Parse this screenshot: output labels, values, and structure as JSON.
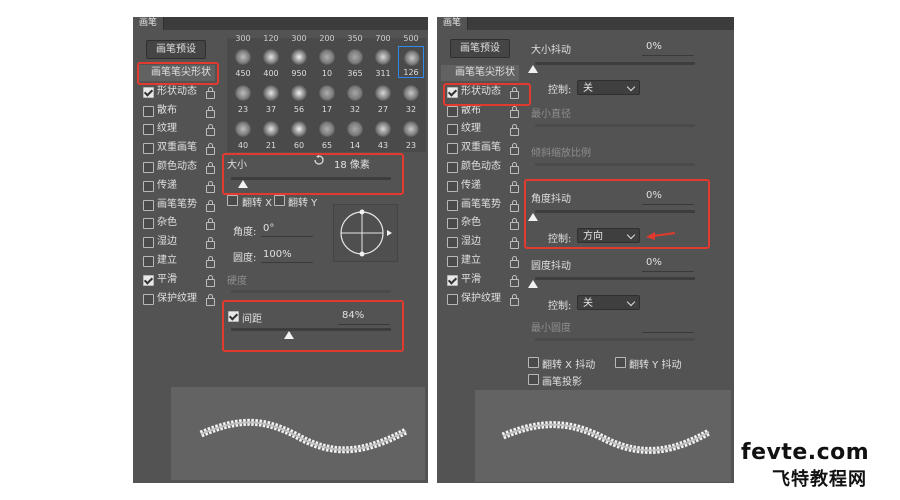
{
  "left_panel": {
    "tab": "画笔",
    "preset_button": "画笔预设",
    "menu": [
      {
        "label": "画笔笔尖形状",
        "checkbox": false,
        "checked": false
      },
      {
        "label": "形状动态",
        "checkbox": true,
        "checked": true
      },
      {
        "label": "散布",
        "checkbox": true,
        "checked": false
      },
      {
        "label": "纹理",
        "checkbox": true,
        "checked": false
      },
      {
        "label": "双重画笔",
        "checkbox": true,
        "checked": false
      },
      {
        "label": "颜色动态",
        "checkbox": true,
        "checked": false
      },
      {
        "label": "传递",
        "checkbox": true,
        "checked": false
      },
      {
        "label": "画笔笔势",
        "checkbox": true,
        "checked": false
      },
      {
        "label": "杂色",
        "checkbox": true,
        "checked": false
      },
      {
        "label": "湿边",
        "checkbox": true,
        "checked": false
      },
      {
        "label": "建立",
        "checkbox": true,
        "checked": false
      },
      {
        "label": "平滑",
        "checkbox": true,
        "checked": true
      },
      {
        "label": "保护纹理",
        "checkbox": true,
        "checked": false
      }
    ],
    "brush_row0": [
      "300",
      "120",
      "300",
      "200",
      "350",
      "700",
      "500"
    ],
    "brush_grid": [
      {
        "size": "450"
      },
      {
        "size": "400"
      },
      {
        "size": "950"
      },
      {
        "size": "10"
      },
      {
        "size": "365"
      },
      {
        "size": "311"
      },
      {
        "size": "126",
        "selected": true
      },
      {
        "size": "23"
      },
      {
        "size": "37"
      },
      {
        "size": "56"
      },
      {
        "size": "17"
      },
      {
        "size": "32"
      },
      {
        "size": "27"
      },
      {
        "size": "32"
      },
      {
        "size": "40"
      },
      {
        "size": "21"
      },
      {
        "size": "60"
      },
      {
        "size": "65"
      },
      {
        "size": "14"
      },
      {
        "size": "43"
      },
      {
        "size": "23"
      }
    ],
    "size_label": "大小",
    "size_value": "18 像素",
    "flip_x": "翻转 X",
    "flip_y": "翻转 Y",
    "angle_label": "角度:",
    "angle_value": "0°",
    "roundness_label": "圆度:",
    "roundness_value": "100%",
    "hardness_label": "硬度",
    "spacing_label": "间距",
    "spacing_value": "84%",
    "spacing_fraction": 0.84
  },
  "right_panel": {
    "tab": "画笔",
    "preset_button": "画笔预设",
    "menu": [
      {
        "label": "画笔笔尖形状",
        "checkbox": false,
        "checked": false
      },
      {
        "label": "形状动态",
        "checkbox": true,
        "checked": true
      },
      {
        "label": "散布",
        "checkbox": true,
        "checked": false
      },
      {
        "label": "纹理",
        "checkbox": true,
        "checked": false
      },
      {
        "label": "双重画笔",
        "checkbox": true,
        "checked": false
      },
      {
        "label": "颜色动态",
        "checkbox": true,
        "checked": false
      },
      {
        "label": "传递",
        "checkbox": true,
        "checked": false
      },
      {
        "label": "画笔笔势",
        "checkbox": true,
        "checked": false
      },
      {
        "label": "杂色",
        "checkbox": true,
        "checked": false
      },
      {
        "label": "湿边",
        "checkbox": true,
        "checked": false
      },
      {
        "label": "建立",
        "checkbox": true,
        "checked": false
      },
      {
        "label": "平滑",
        "checkbox": true,
        "checked": true
      },
      {
        "label": "保护纹理",
        "checkbox": true,
        "checked": false
      }
    ],
    "size_jitter_label": "大小抖动",
    "size_jitter_value": "0%",
    "control_label": "控制:",
    "control_off": "关",
    "min_diameter_label": "最小直径",
    "tilt_scale_label": "倾斜缩放比例",
    "angle_jitter_label": "角度抖动",
    "angle_jitter_value": "0%",
    "angle_control_value": "方向",
    "roundness_jitter_label": "圆度抖动",
    "roundness_jitter_value": "0%",
    "roundness_control_value": "关",
    "min_roundness_label": "最小圆度",
    "flip_x_jitter": "翻转 X 抖动",
    "flip_y_jitter": "翻转 Y 抖动",
    "brush_projection": "画笔投影"
  },
  "watermark": {
    "line1": "fevte.com",
    "line2": "飞特教程网"
  },
  "colors": {
    "panel_bg": "#535353",
    "highlight_red": "#e23a2e",
    "selected_blue": "#2d8ceb"
  }
}
